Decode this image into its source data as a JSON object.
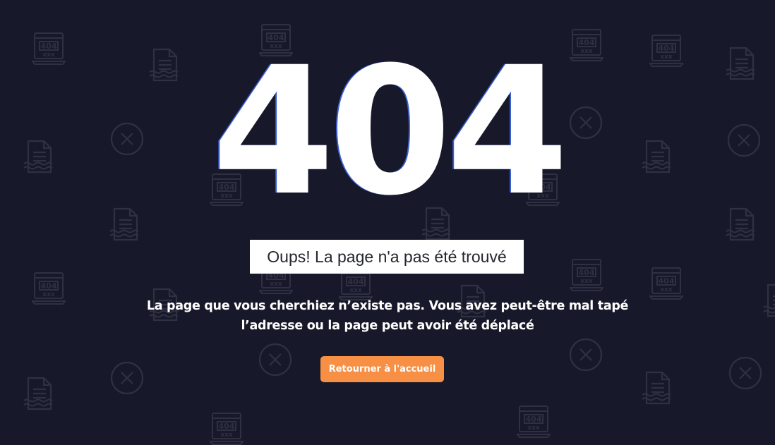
{
  "error": {
    "code": "404",
    "title": "Oups! La page n'a pas été trouvé",
    "message": "La page que vous cherchiez n’existe pas. Vous avez peut-être mal tapé l’adresse ou la page peut avoir été déplacé",
    "button_label": "Retourner à l'accueil"
  },
  "background": {
    "pattern_icons": [
      "laptop-404-icon",
      "document-icon",
      "close-circle-icon"
    ],
    "icon_404_text": "404",
    "icon_xxx_text": "xxx"
  },
  "colors": {
    "background": "#171829",
    "pattern": "#2f3143",
    "text": "#ffffff",
    "subtitle_box": "#ffffff",
    "subtitle_text": "#24262f",
    "button": "#f78f45"
  }
}
